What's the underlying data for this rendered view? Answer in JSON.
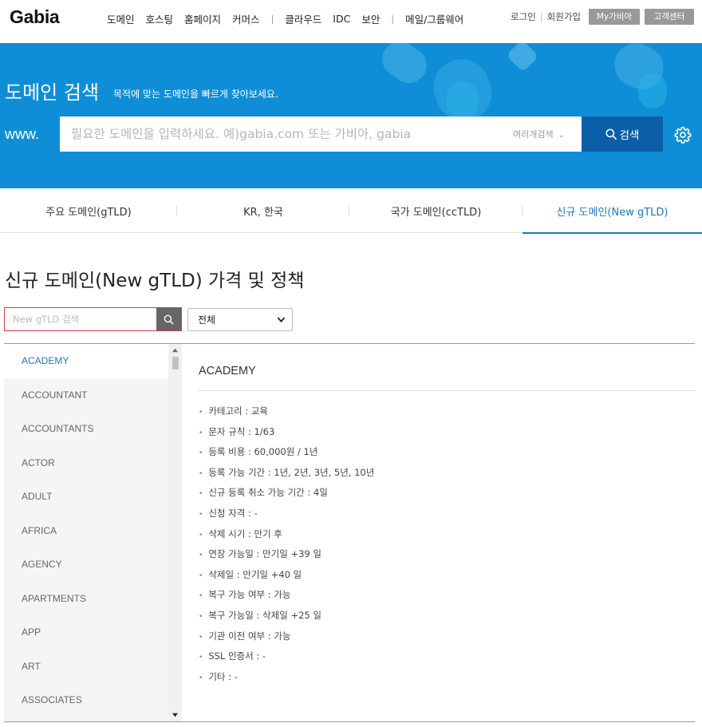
{
  "header": {
    "logo": "Gabia",
    "nav": [
      "도메인",
      "호스팅",
      "홈페이지",
      "커머스",
      "클라우드",
      "IDC",
      "보안",
      "메일/그룹웨어"
    ],
    "nav_separator": "|",
    "util": {
      "login": "로그인",
      "signup": "회원가입",
      "separator": "|",
      "my_gabia": "My가비아",
      "support": "고객센터"
    }
  },
  "hero": {
    "title": "도메인 검색",
    "subtitle": "목적에 맞는 도메인을 빠르게 찾아보세요.",
    "prefix": "www.",
    "search_placeholder": "필요한 도메인을 입력하세요. 예)gabia.com 또는 가비아, gabia",
    "multi_search": "여러개검색",
    "search_button": "검색"
  },
  "tabs": [
    {
      "label": "주요 도메인(gTLD)",
      "active": false
    },
    {
      "label": "KR, 한국",
      "active": false
    },
    {
      "label": "국가 도메인(ccTLD)",
      "active": false
    },
    {
      "label": "신규 도메인(New gTLD)",
      "active": true
    }
  ],
  "page_title": "신규 도메인(New gTLD) 가격 및 정책",
  "filter": {
    "placeholder": "New gTLD 검색",
    "select_value": "전체"
  },
  "domain_list": [
    "ACADEMY",
    "ACCOUNTANT",
    "ACCOUNTANTS",
    "ACTOR",
    "ADULT",
    "AFRICA",
    "AGENCY",
    "APARTMENTS",
    "APP",
    "ART",
    "ASSOCIATES"
  ],
  "selected_index": 0,
  "detail": {
    "title": "ACADEMY",
    "items": [
      "카테고리 : 교육",
      "문자 규칙 : 1/63",
      "등록 비용 : 60,000원 / 1년",
      "등록 가능 기간 : 1년, 2년, 3년, 5년, 10년",
      "신규 등록 취소 가능 기간 : 4일",
      "신청 자격 : -",
      "삭제 시기 : 만기 후",
      "연장 가능일 : 만기일 +39 일",
      "삭제일 : 만기일 +40 일",
      "복구 가능 여부 : 가능",
      "복구 가능일 : 삭제일 +25 일",
      "기관 이전 여부 : 가능",
      "SSL 인증서 : -",
      "기타 : -"
    ]
  },
  "colors": {
    "hero_bg": "#0f8ed7",
    "search_button": "#0b5fa8",
    "active_tab": "#1a78c2",
    "filter_border": "#e0383e"
  }
}
